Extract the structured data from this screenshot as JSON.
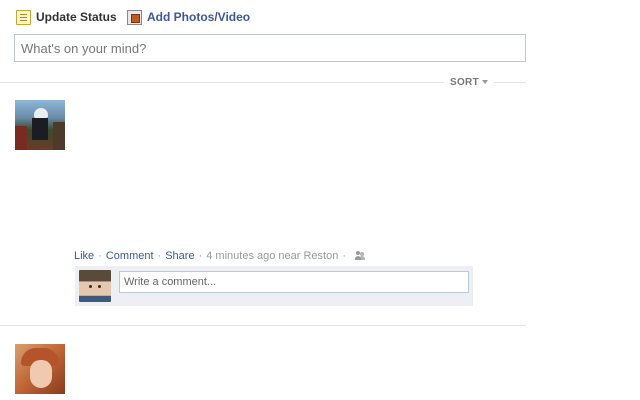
{
  "composer": {
    "tabs": [
      {
        "label": "Update Status",
        "icon": "status-note-icon"
      },
      {
        "label": "Add Photos/Video",
        "icon": "photo-icon"
      }
    ],
    "input_placeholder": "What's on your mind?"
  },
  "feed": {
    "sort_label": "SORT",
    "stories": [
      {
        "avatar": "user-avatar",
        "actions": {
          "like": "Like",
          "comment": "Comment",
          "share": "Share",
          "separator": "·",
          "timestamp": "4 minutes ago near Reston",
          "audience_icon": "friends-icon"
        },
        "comment_box": {
          "avatar": "viewer-avatar",
          "placeholder": "Write a comment..."
        }
      },
      {
        "avatar": "user-avatar"
      }
    ]
  },
  "colors": {
    "link": "#3b5998",
    "meta_text": "#999999",
    "comment_bg": "#edeff4",
    "input_border": "#bdc7d8"
  }
}
